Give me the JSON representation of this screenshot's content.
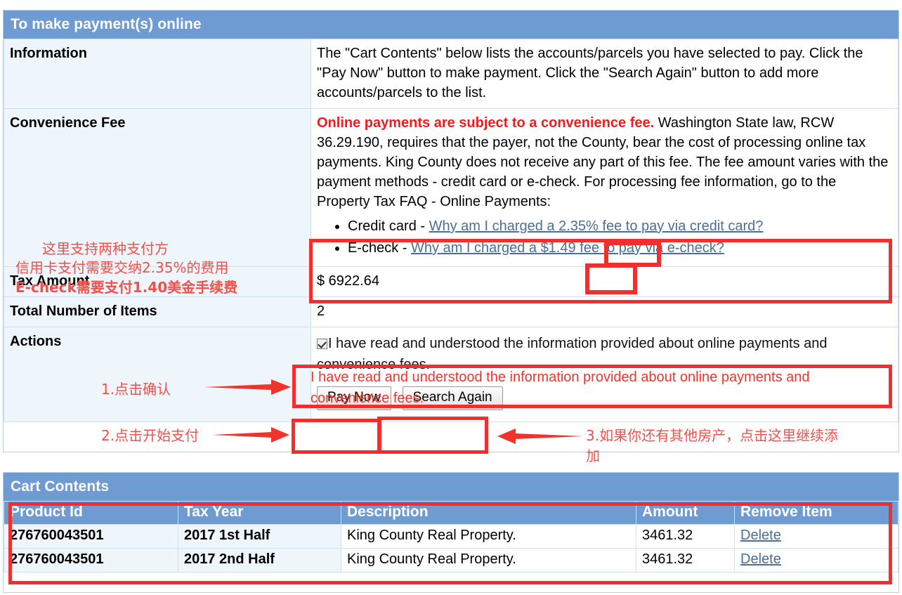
{
  "info_panel": {
    "header": "To make payment(s) online",
    "rows": {
      "information": {
        "label": "Information",
        "text": "The \"Cart Contents\" below lists the accounts/parcels you have selected to pay.  Click the \"Pay Now\" button to make payment.  Click the \"Search Again\" button to add more accounts/parcels to the list."
      },
      "convenience_fee": {
        "label": "Convenience Fee",
        "bold_lead": "Online payments are subject to a convenience fee.",
        "body": " Washington State law, RCW 36.29.190, requires that the payer, not the County, bear the cost of processing online tax payments.  King County does not receive any part of this fee.  The fee amount varies with the payment methods - credit card or e-check.  For processing fee information, go to the Property Tax FAQ - Online Payments:",
        "fees": [
          {
            "prefix": "Credit card - ",
            "link_pre": "Why am I charged a ",
            "highlight": "2.35%",
            "link_post": " fee to pay via credit card?"
          },
          {
            "prefix": "E-check - ",
            "link_pre": "Why am I charged a ",
            "highlight": "$1.49",
            "link_post": " fee to pay via e-check?"
          }
        ]
      },
      "tax_amount": {
        "label": "Tax Amount",
        "value": "$ 6922.64"
      },
      "total_items": {
        "label": "Total Number of Items",
        "value": "2"
      },
      "actions": {
        "label": "Actions",
        "checkbox_text": "I have read and understood the information provided about online payments and convenience fees.",
        "checkbox_checked": "true",
        "pay_now_label": "Pay Now",
        "search_again_label": "Search Again"
      }
    }
  },
  "annotations": {
    "fee_note_line1": "这里支持两种支付方",
    "fee_note_line2": "信用卡支付需要交纳2.35%的费用",
    "fee_note_line3": "E-check需要支付1.40美金手续费",
    "step1": "1.点击确认",
    "step2": "2.点击开始支付",
    "step3_line1": "3.如果你还有其他房产，点击这里继续添",
    "step3_line2": "加",
    "highlight_color": "#f62d2d",
    "text_color": "#f4504a"
  },
  "cart_panel": {
    "header": "Cart Contents",
    "columns": [
      "Product Id",
      "Tax Year",
      "Description",
      "Amount",
      "Remove Item"
    ],
    "rows": [
      {
        "product_id": "276760043501",
        "tax_year": "2017 1st Half",
        "description": "King County Real Property.",
        "amount": "3461.32",
        "remove": "Delete"
      },
      {
        "product_id": "276760043501",
        "tax_year": "2017 2nd Half",
        "description": "King County Real Property.",
        "amount": "3461.32",
        "remove": "Delete"
      }
    ]
  }
}
